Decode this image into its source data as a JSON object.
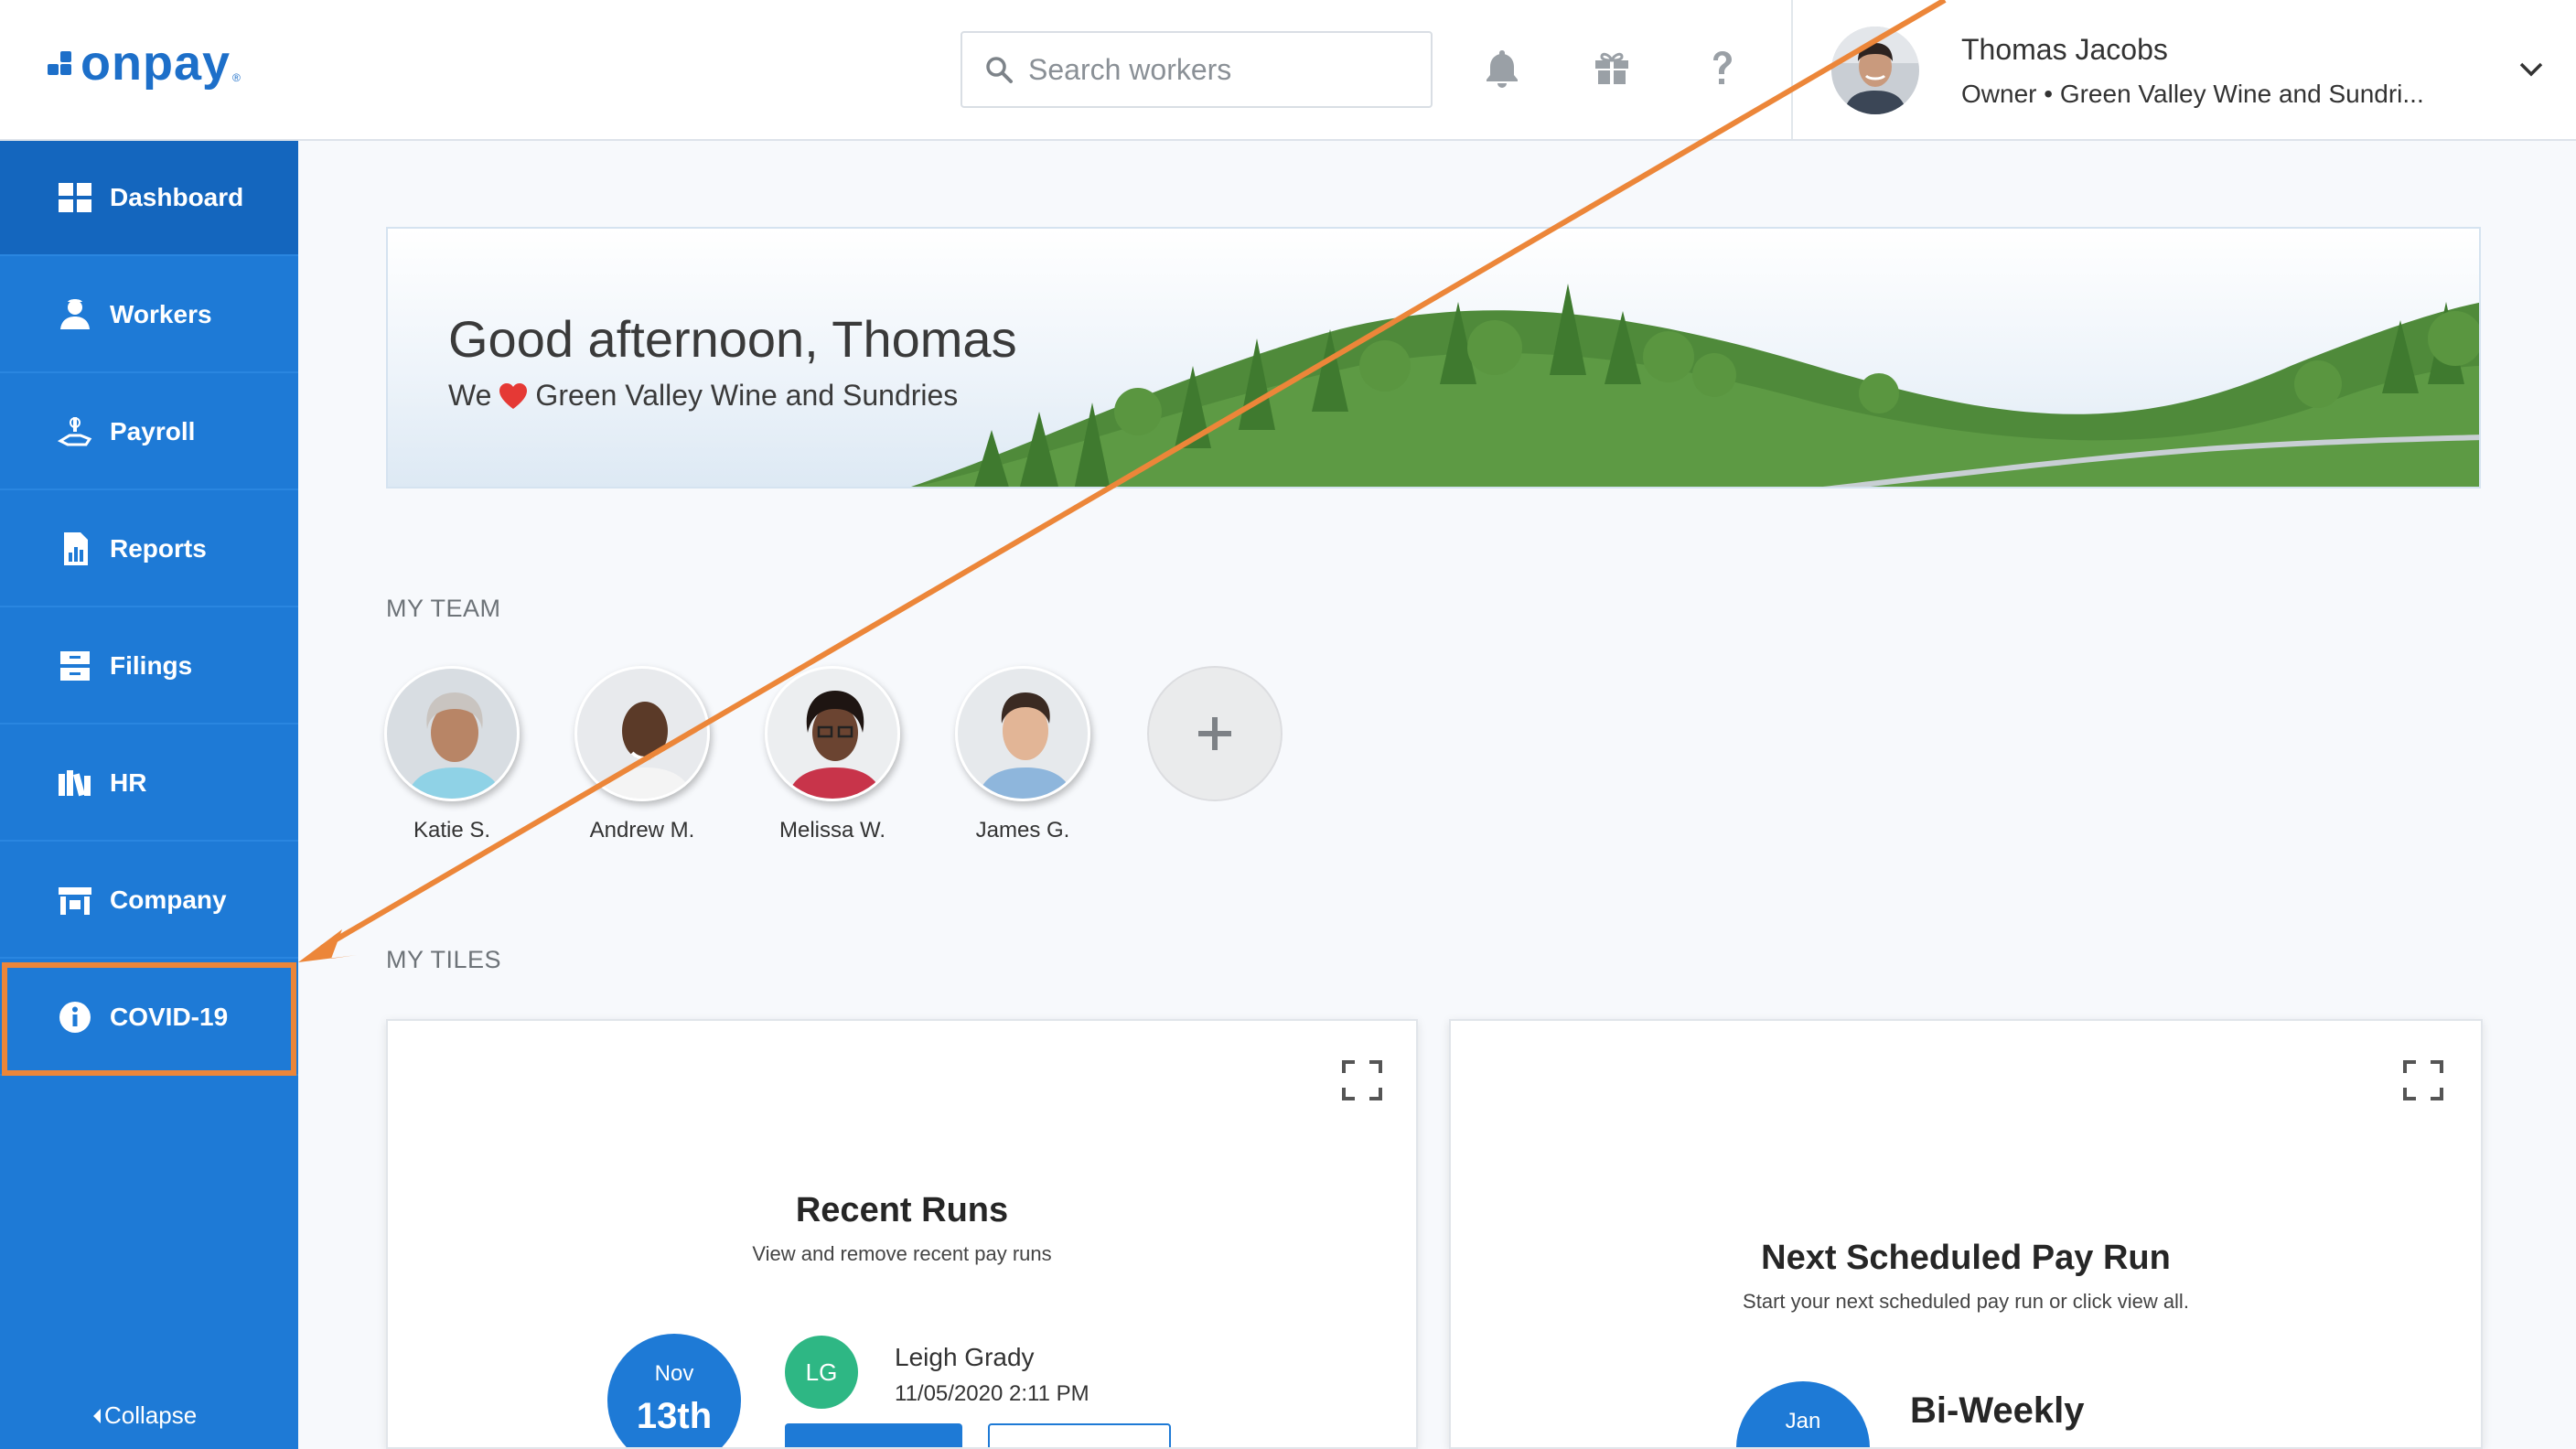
{
  "brand": {
    "name": "onpay",
    "reg": "®",
    "color": "#1d6fc9"
  },
  "header": {
    "search": {
      "placeholder": "Search workers",
      "icon": "search-icon"
    },
    "icons": [
      "bell-icon",
      "gift-icon",
      "help-icon"
    ],
    "user": {
      "name": "Thomas Jacobs",
      "role": "Owner • Green Valley Wine and Sundri..."
    }
  },
  "sidebar": {
    "items": [
      {
        "label": "Dashboard",
        "icon": "dashboard-icon",
        "active": true
      },
      {
        "label": "Workers",
        "icon": "workers-icon"
      },
      {
        "label": "Payroll",
        "icon": "payroll-icon"
      },
      {
        "label": "Reports",
        "icon": "reports-icon"
      },
      {
        "label": "Filings",
        "icon": "filings-icon"
      },
      {
        "label": "HR",
        "icon": "hr-icon"
      },
      {
        "label": "Company",
        "icon": "company-icon"
      },
      {
        "label": "COVID-19",
        "icon": "info-icon",
        "highlighted": true
      }
    ],
    "collapse_label": "Collapse",
    "color": "#1e7ad6"
  },
  "banner": {
    "greeting": "Good afternoon, Thomas",
    "tagline_before": "We",
    "tagline_after": "Green Valley Wine and Sundries"
  },
  "team": {
    "title": "MY TEAM",
    "members": [
      {
        "name": "Katie S."
      },
      {
        "name": "Andrew M."
      },
      {
        "name": "Melissa W."
      },
      {
        "name": "James G."
      }
    ]
  },
  "tiles": {
    "title": "MY TILES",
    "recent_runs": {
      "title": "Recent Runs",
      "subtitle": "View and remove recent pay runs",
      "date_month": "Nov",
      "date_day": "13th",
      "initials": "LG",
      "person": "Leigh Grady",
      "timestamp": "11/05/2020 2:11 PM"
    },
    "next_run": {
      "title": "Next Scheduled Pay Run",
      "subtitle": "Start your next scheduled pay run or click view all.",
      "date_month": "Jan",
      "frequency": "Bi-Weekly"
    }
  },
  "annotation": {
    "color": "#ec8639",
    "target": "COVID-19"
  }
}
